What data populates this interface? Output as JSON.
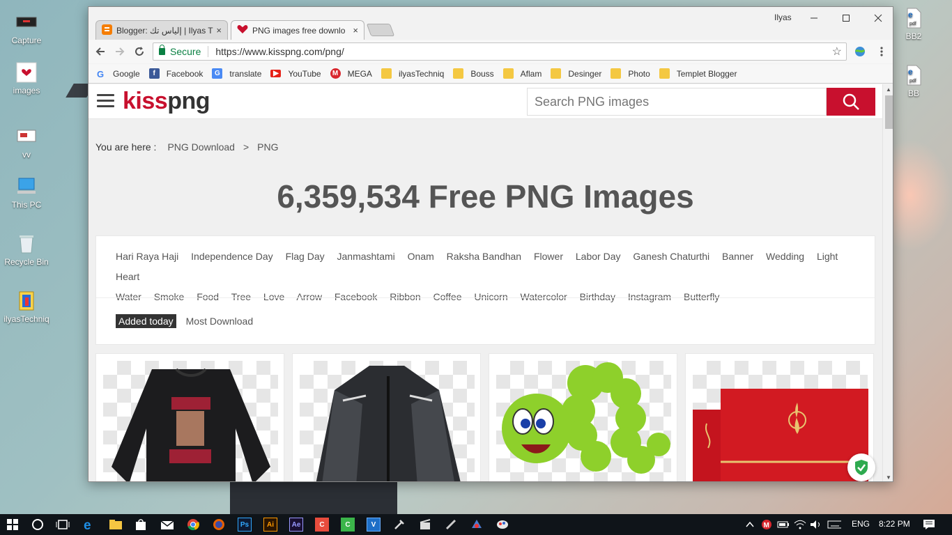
{
  "desktop": {
    "icons_left": [
      {
        "label": "Capture",
        "icon": "screenshot-icon"
      },
      {
        "label": "images",
        "icon": "kisspng-image-icon"
      },
      {
        "label": "vv",
        "icon": "video-file-icon"
      },
      {
        "label": "This PC",
        "icon": "computer-icon"
      },
      {
        "label": "Recycle Bin",
        "icon": "recycle-bin-icon"
      },
      {
        "label": "ilyasTechniq",
        "icon": "app-shortcut-icon"
      }
    ],
    "icons_right": [
      {
        "label": "BB2",
        "icon": "pdf-file-icon"
      },
      {
        "label": "BB",
        "icon": "pdf-file-icon"
      }
    ]
  },
  "browser": {
    "user": "Ilyas",
    "tabs": [
      {
        "title": "Blogger: إلياس تك | Ilyas T",
        "close": "×",
        "favicon": "blogger-icon"
      },
      {
        "title": "PNG images free downlo",
        "close": "×",
        "favicon": "heart-icon"
      }
    ],
    "address": {
      "secure_label": "Secure",
      "url": "https://www.kisspng.com/png/"
    },
    "bookmarks": [
      {
        "label": "Google",
        "icon": "google-icon"
      },
      {
        "label": "Facebook",
        "icon": "facebook-icon"
      },
      {
        "label": "translate",
        "icon": "translate-icon"
      },
      {
        "label": "YouTube",
        "icon": "youtube-icon"
      },
      {
        "label": "MEGA",
        "icon": "mega-icon"
      },
      {
        "label": "ilyasTechniq",
        "icon": "folder-icon"
      },
      {
        "label": "Bouss",
        "icon": "folder-icon"
      },
      {
        "label": "Aflam",
        "icon": "folder-icon"
      },
      {
        "label": "Desinger",
        "icon": "folder-icon"
      },
      {
        "label": "Photo",
        "icon": "folder-icon"
      },
      {
        "label": "Templet Blogger",
        "icon": "folder-icon"
      }
    ]
  },
  "site": {
    "logo_kiss": "kiss",
    "logo_png": "png",
    "search_placeholder": "Search PNG images",
    "breadcrumb": {
      "prefix": "You are here :",
      "items": [
        "PNG Download",
        "PNG"
      ],
      "separator": ">"
    },
    "headline": "6,359,534 Free PNG Images",
    "tags": [
      "Hari Raya Haji",
      "Independence Day",
      "Flag Day",
      "Janmashtami",
      "Onam",
      "Raksha Bandhan",
      "Flower",
      "Labor Day",
      "Ganesh Chaturthi",
      "Banner",
      "Wedding",
      "Light",
      "Heart",
      "Water",
      "Smoke",
      "Food",
      "Tree",
      "Love",
      "Arrow",
      "Facebook",
      "Ribbon",
      "Coffee",
      "Unicorn",
      "Watercolor",
      "Birthday",
      "Instagram",
      "Butterfly"
    ],
    "sort": {
      "active": "Added today",
      "inactive": "Most Download"
    },
    "cards": [
      {
        "subject": "black sweatshirt"
      },
      {
        "subject": "motorcycle jacket"
      },
      {
        "subject": "green cartoon caterpillar"
      },
      {
        "subject": "red wedding invitation"
      }
    ],
    "brand_color": "#c8102e"
  },
  "taskbar": {
    "apps": [
      "windows-start-icon",
      "cortana-icon",
      "task-view-icon",
      "edge-icon",
      "file-explorer-icon",
      "store-icon",
      "mail-icon",
      "chrome-icon",
      "firefox-icon",
      "photoshop-icon",
      "illustrator-icon",
      "after-effects-icon",
      "camtasia-icon",
      "camtasia-recorder-icon",
      "vsdc-icon",
      "tool-icon",
      "movie-maker-icon",
      "pen-icon",
      "vpn-icon",
      "paint-icon"
    ],
    "app_labels": {
      "ps": "Ps",
      "ai": "Ai",
      "ae": "Ae",
      "c": "C",
      "v": "V"
    },
    "language": "ENG",
    "time": "8:22 PM"
  }
}
